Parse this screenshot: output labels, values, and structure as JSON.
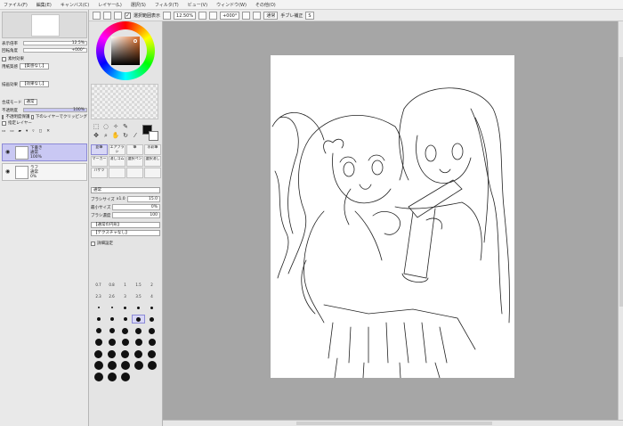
{
  "menu": [
    "ファイル(F)",
    "編集(E)",
    "キャンバス(C)",
    "レイヤー(L)",
    "選択(S)",
    "フィルタ(T)",
    "ビュー(V)",
    "ウィンドウ(W)",
    "その他(O)"
  ],
  "toolbar": {
    "selection_check": "✓",
    "selection_label": "選択範囲表示",
    "zoom": "12.50%",
    "rotation": "+000°",
    "mode": "通常",
    "stabilizer_label": "手ブレ補正",
    "stabilizer_value": "S"
  },
  "navigator": {
    "zoom_label": "表示倍率",
    "zoom_value": "12.5%",
    "angle_label": "回転角度",
    "angle_value": "+000°"
  },
  "layer_props": {
    "effect_header": "素材効果",
    "texture_label": "用紙質感",
    "texture_value": "【質感なし】",
    "effect_label": "描画効果",
    "effect_value": "【効果なし】",
    "blend_label": "合成モード",
    "blend_value": "通常",
    "opacity_label": "不透明度",
    "opacity_value": "100%",
    "preserve_opacity": "不透明度保護",
    "clip_lower": "下のレイヤーでクリッピング",
    "ref_layer": "指定レイヤー"
  },
  "layers": [
    {
      "name": "下書き",
      "mode": "通常",
      "opacity": "100%",
      "selected": true
    },
    {
      "name": "ラフ",
      "mode": "通常",
      "opacity": "0%",
      "selected": false
    }
  ],
  "brushes": [
    {
      "label": "鉛筆",
      "on": true
    },
    {
      "label": "エアブラシ",
      "on": false
    },
    {
      "label": "筆",
      "on": false
    },
    {
      "label": "水彩筆",
      "on": false
    },
    {
      "label": "マーカー",
      "on": false
    },
    {
      "label": "消しゴム",
      "on": false
    },
    {
      "label": "選択ペン",
      "on": false
    },
    {
      "label": "選択消し",
      "on": false
    },
    {
      "label": "バケツ",
      "on": false
    },
    {
      "label": "",
      "on": false
    },
    {
      "label": "",
      "on": false
    },
    {
      "label": "",
      "on": false
    }
  ],
  "brush_settings": {
    "mode": "通常",
    "size_label": "ブラシサイズ",
    "size_mult": "x1.0",
    "size_value": "15.0",
    "min_label": "最小サイズ",
    "min_value": "0%",
    "density_label": "ブラシ濃度",
    "density_value": "100",
    "shape_value": "【通常の円形】",
    "texture_value": "【テクスチャなし】",
    "detail_label": "詳細設定"
  },
  "size_labels": [
    "0.7",
    "0.8",
    "1",
    "1.5",
    "2",
    "2.3",
    "2.6",
    "3",
    "3.5",
    "4"
  ],
  "colors": {
    "accent": "#8c8ad6",
    "fg": "#111111",
    "bg": "#ffffff",
    "canvas_bg": "#a6a6a6"
  }
}
